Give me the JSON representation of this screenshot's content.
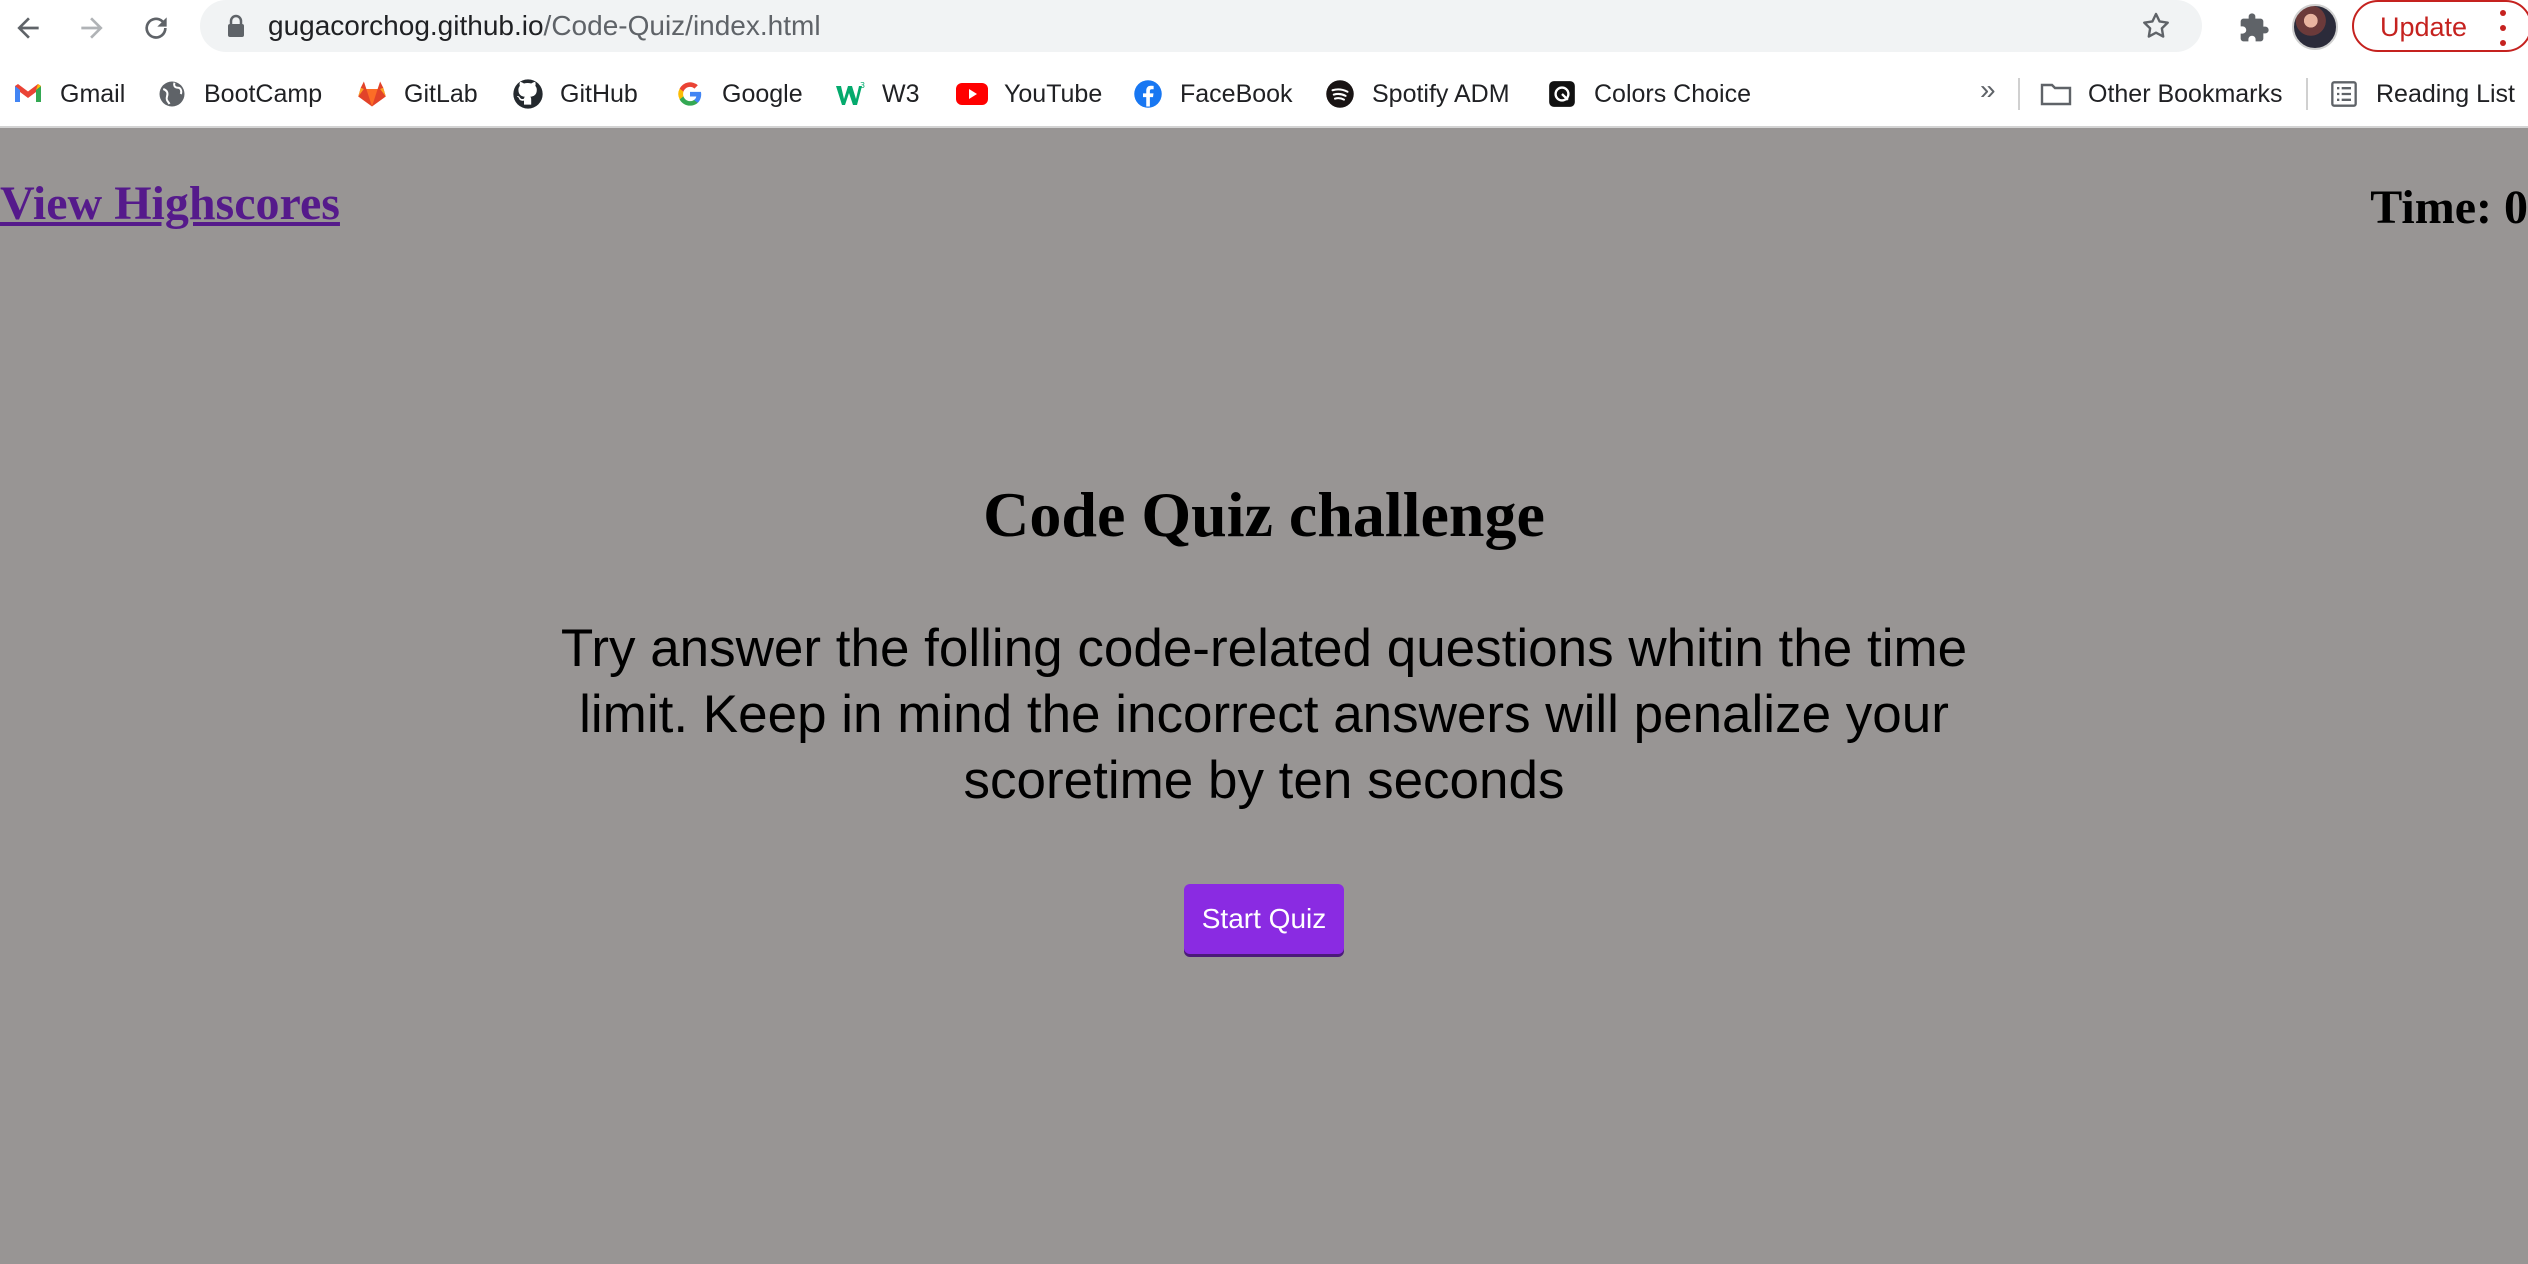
{
  "browser": {
    "url_host": "gugacorchog.github.io",
    "url_path": "/Code-Quiz/index.html",
    "update_label": "Update",
    "bookmarks": [
      {
        "label": "Gmail",
        "icon": "gmail-icon"
      },
      {
        "label": "BootCamp",
        "icon": "globe-icon"
      },
      {
        "label": "GitLab",
        "icon": "gitlab-icon"
      },
      {
        "label": "GitHub",
        "icon": "github-icon"
      },
      {
        "label": "Google",
        "icon": "google-icon"
      },
      {
        "label": "W3",
        "icon": "w3-icon"
      },
      {
        "label": "YouTube",
        "icon": "youtube-icon"
      },
      {
        "label": "FaceBook",
        "icon": "facebook-icon"
      },
      {
        "label": "Spotify ADM",
        "icon": "spotify-icon"
      },
      {
        "label": "Colors Choice",
        "icon": "colors-choice-icon"
      }
    ],
    "overflow_label": "»",
    "other_bookmarks": "Other Bookmarks",
    "reading_list": "Reading List"
  },
  "page": {
    "highscores_link": "View Highscores",
    "timer_label": "Time:",
    "timer_value": "0",
    "title": "Code Quiz challenge",
    "intro": "Try answer the folling code-related questions whitin the time limit. Keep in mind the incorrect answers will penalize your scoretime by ten seconds",
    "start_button": "Start Quiz"
  },
  "colors": {
    "background": "#989594",
    "accent": "#8a2be2",
    "link": "#551a8b",
    "update": "#c5221f"
  }
}
